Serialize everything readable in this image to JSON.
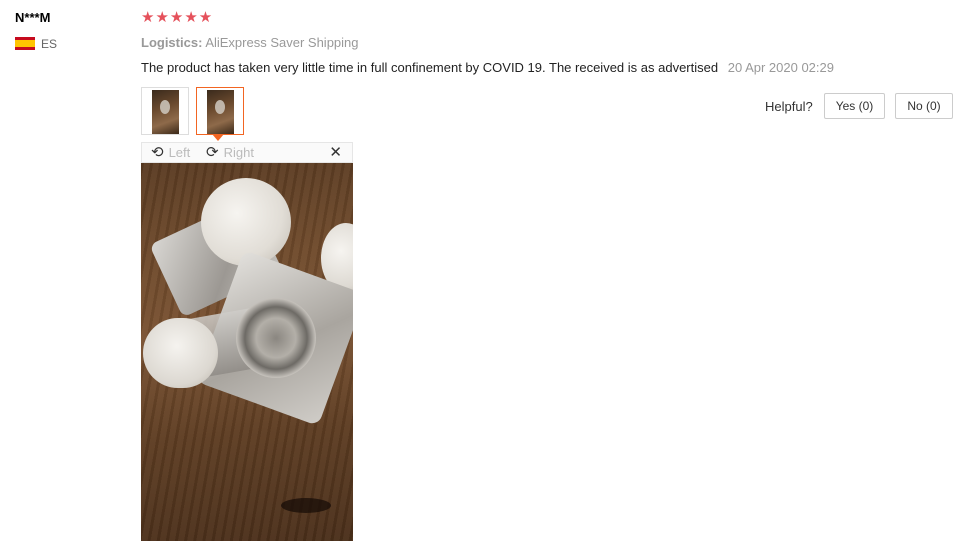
{
  "reviewer": {
    "name": "N***M",
    "country_code": "ES",
    "flag_icon": "spain-flag-icon"
  },
  "review": {
    "rating": 5,
    "stars": "★★★★★",
    "star_color": "#e5515b",
    "logistics_label": "Logistics:",
    "logistics_value": "AliExpress Saver Shipping",
    "text": "The product has taken very little time in full confinement by COVID 19. The received is as advertised",
    "date": "20 Apr 2020 02:29"
  },
  "thumbnails": [
    {
      "name": "review-photo-1",
      "selected": false
    },
    {
      "name": "review-photo-2",
      "selected": true
    }
  ],
  "helpful": {
    "label": "Helpful?",
    "yes_label": "Yes (0)",
    "no_label": "No (0)"
  },
  "viewer": {
    "rotate_left_label": "Left",
    "rotate_right_label": "Right",
    "rotate_left_icon": "⟲",
    "rotate_right_icon": "⟳",
    "close_icon": "✕",
    "accent_color": "#f26522"
  }
}
